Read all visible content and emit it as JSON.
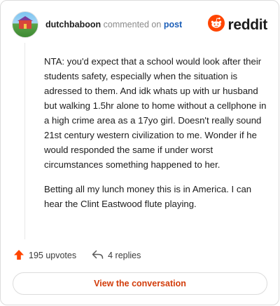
{
  "header": {
    "username": "dutchbaboon",
    "action_text": "commented on",
    "post_link": "post",
    "brand_name": "reddit"
  },
  "comment": {
    "paragraphs": [
      "NTA: you'd expect that a school would look after their students safety, especially when the situation is adressed to them. And idk whats up with ur husband but walking 1.5hr alone to home without a cellphone in a high crime area as a 17yo girl. Doesn't really sound 21st century western civilization to me. Wonder if he would responded the same if under worst circumstances something happened to her.",
      "Betting all my lunch money this is in America. I can hear the Clint Eastwood flute playing."
    ]
  },
  "actions": {
    "upvotes_label": "195 upvotes",
    "replies_label": "4 replies"
  },
  "cta": {
    "view_label": "View the conversation"
  },
  "colors": {
    "reddit_orange": "#ff4500",
    "link_blue": "#1c5fb8",
    "cta_text": "#d23c0a",
    "border": "#dcdcdc"
  },
  "icons": [
    "reddit-logo-icon",
    "upvote-arrow-icon",
    "reply-arrow-icon"
  ]
}
